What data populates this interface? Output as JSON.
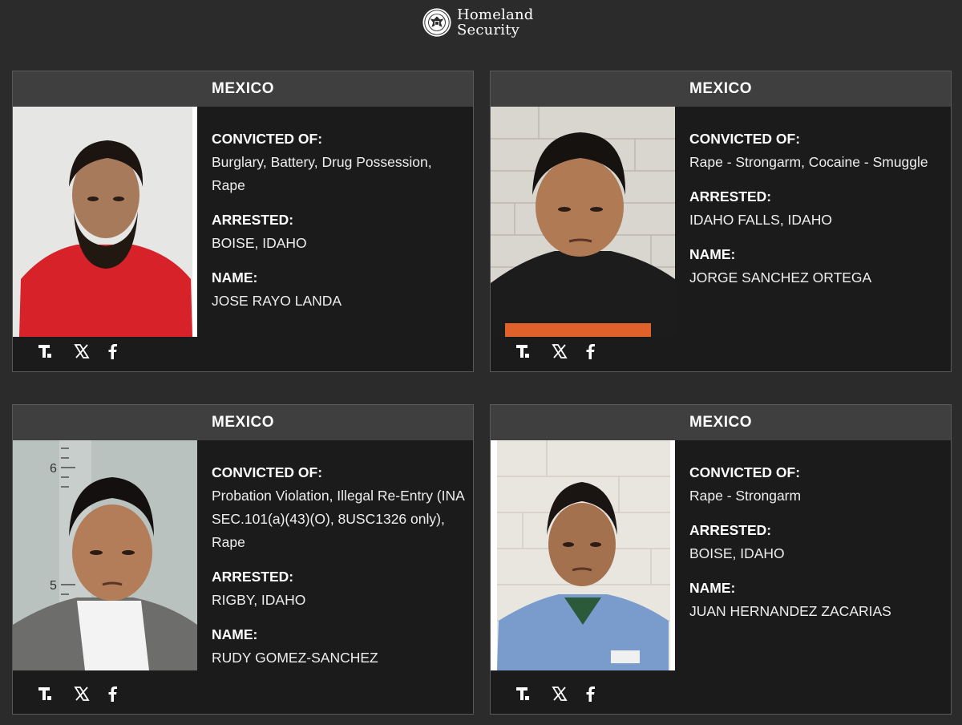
{
  "header": {
    "logo_line1": "Homeland",
    "logo_line2": "Security",
    "seal_icon": "dhs-seal-icon"
  },
  "cards": [
    {
      "country": "MEXICO",
      "convicted_label": "CONVICTED OF:",
      "convicted": "Burglary, Battery, Drug Possession, Rape",
      "arrested_label": "ARRESTED:",
      "arrested": "BOISE, IDAHO",
      "name_label": "NAME:",
      "name": "JOSE RAYO LANDA"
    },
    {
      "country": "MEXICO",
      "convicted_label": "CONVICTED OF:",
      "convicted": "Rape - Strongarm, Cocaine - Smuggle",
      "arrested_label": "ARRESTED:",
      "arrested": "IDAHO FALLS, IDAHO",
      "name_label": "NAME:",
      "name": "JORGE SANCHEZ ORTEGA"
    },
    {
      "country": "MEXICO",
      "convicted_label": "CONVICTED OF:",
      "convicted": "Probation Violation, Illegal Re-Entry (INA SEC.101(a)(43)(O), 8USC1326 only), Rape",
      "arrested_label": "ARRESTED:",
      "arrested": "RIGBY, IDAHO",
      "name_label": "NAME:",
      "name": "RUDY GOMEZ-SANCHEZ"
    },
    {
      "country": "MEXICO",
      "convicted_label": "CONVICTED OF:",
      "convicted": "Rape - Strongarm",
      "arrested_label": "ARRESTED:",
      "arrested": "BOISE, IDAHO",
      "name_label": "NAME:",
      "name": "JUAN HERNANDEZ ZACARIAS"
    }
  ],
  "social": {
    "icons": [
      "truth-social-icon",
      "x-icon",
      "facebook-icon"
    ]
  }
}
